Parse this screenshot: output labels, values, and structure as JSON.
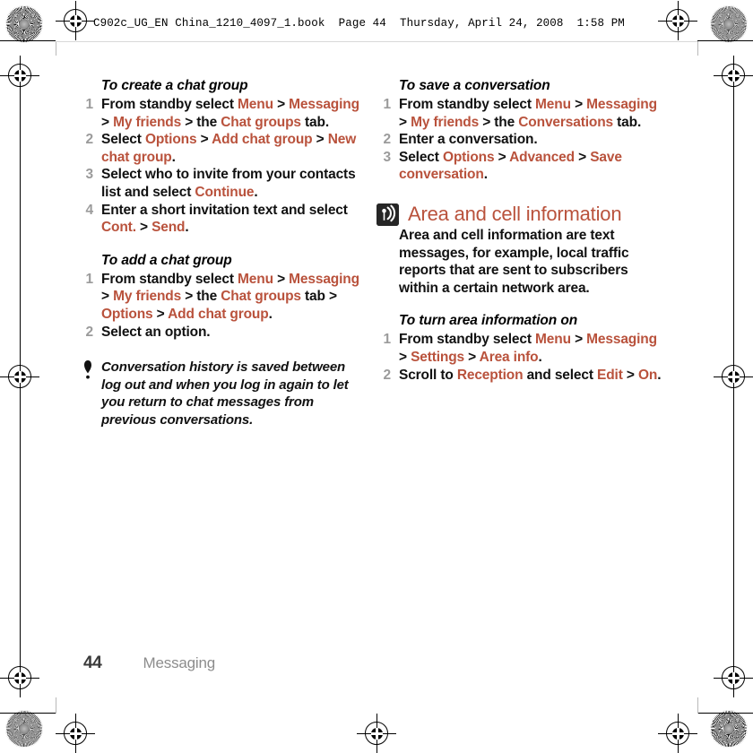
{
  "print_header": {
    "text": "C902c_UG_EN China_1210_4097_1.book  Page 44  Thursday, April 24, 2008  1:58 PM"
  },
  "accent_color": "#b9523c",
  "number_color": "#9b9b9b",
  "left_column": {
    "sections": [
      {
        "heading": "To create a chat group",
        "steps": [
          [
            {
              "t": "plain",
              "v": "From standby select "
            },
            {
              "t": "ui",
              "v": "Menu"
            },
            {
              "t": "sep",
              "v": " > "
            },
            {
              "t": "ui",
              "v": "Messaging"
            },
            {
              "t": "sep",
              "v": " > "
            },
            {
              "t": "ui",
              "v": "My friends"
            },
            {
              "t": "sep",
              "v": " > "
            },
            {
              "t": "plain",
              "v": "the "
            },
            {
              "t": "ui",
              "v": "Chat groups"
            },
            {
              "t": "plain",
              "v": " tab."
            }
          ],
          [
            {
              "t": "plain",
              "v": "Select "
            },
            {
              "t": "ui",
              "v": "Options"
            },
            {
              "t": "sep",
              "v": " > "
            },
            {
              "t": "ui",
              "v": "Add chat group"
            },
            {
              "t": "sep",
              "v": " > "
            },
            {
              "t": "ui",
              "v": "New chat group"
            },
            {
              "t": "plain",
              "v": "."
            }
          ],
          [
            {
              "t": "plain",
              "v": "Select who to invite from your contacts list and select "
            },
            {
              "t": "ui",
              "v": "Continue"
            },
            {
              "t": "plain",
              "v": "."
            }
          ],
          [
            {
              "t": "plain",
              "v": "Enter a short invitation text and select "
            },
            {
              "t": "ui",
              "v": "Cont."
            },
            {
              "t": "sep",
              "v": " > "
            },
            {
              "t": "ui",
              "v": "Send"
            },
            {
              "t": "plain",
              "v": "."
            }
          ]
        ]
      },
      {
        "heading": "To add a chat group",
        "steps": [
          [
            {
              "t": "plain",
              "v": "From standby select "
            },
            {
              "t": "ui",
              "v": "Menu"
            },
            {
              "t": "sep",
              "v": " > "
            },
            {
              "t": "ui",
              "v": "Messaging"
            },
            {
              "t": "sep",
              "v": " > "
            },
            {
              "t": "ui",
              "v": "My friends"
            },
            {
              "t": "sep",
              "v": " > "
            },
            {
              "t": "plain",
              "v": "the "
            },
            {
              "t": "ui",
              "v": "Chat groups"
            },
            {
              "t": "plain",
              "v": " tab "
            },
            {
              "t": "sep",
              "v": "> "
            },
            {
              "t": "ui",
              "v": "Options"
            },
            {
              "t": "sep",
              "v": " > "
            },
            {
              "t": "ui",
              "v": "Add chat group"
            },
            {
              "t": "plain",
              "v": "."
            }
          ],
          [
            {
              "t": "plain",
              "v": "Select an option."
            }
          ]
        ]
      }
    ],
    "tip": {
      "icon": "exclamation-tip-icon",
      "text": "Conversation history is saved between log out and when you log in again to let you return to chat messages from previous conversations."
    }
  },
  "right_column": {
    "sections": [
      {
        "heading": "To save a conversation",
        "steps": [
          [
            {
              "t": "plain",
              "v": "From standby select "
            },
            {
              "t": "ui",
              "v": "Menu"
            },
            {
              "t": "sep",
              "v": " > "
            },
            {
              "t": "ui",
              "v": "Messaging"
            },
            {
              "t": "sep",
              "v": " > "
            },
            {
              "t": "ui",
              "v": "My friends"
            },
            {
              "t": "sep",
              "v": " > "
            },
            {
              "t": "plain",
              "v": "the "
            },
            {
              "t": "ui",
              "v": "Conversations"
            },
            {
              "t": "plain",
              "v": " tab."
            }
          ],
          [
            {
              "t": "plain",
              "v": "Enter a conversation."
            }
          ],
          [
            {
              "t": "plain",
              "v": "Select "
            },
            {
              "t": "ui",
              "v": "Options"
            },
            {
              "t": "sep",
              "v": " > "
            },
            {
              "t": "ui",
              "v": "Advanced"
            },
            {
              "t": "sep",
              "v": " > "
            },
            {
              "t": "ui",
              "v": "Save conversation"
            },
            {
              "t": "plain",
              "v": "."
            }
          ]
        ]
      }
    ],
    "section_heading": {
      "icon": "antenna-broadcast-icon",
      "title": "Area and cell information",
      "paragraph": "Area and cell information are text messages, for example, local traffic reports that are sent to subscribers within a certain network area."
    },
    "sections_after": [
      {
        "heading": "To turn area information on",
        "steps": [
          [
            {
              "t": "plain",
              "v": "From standby select "
            },
            {
              "t": "ui",
              "v": "Menu"
            },
            {
              "t": "sep",
              "v": " > "
            },
            {
              "t": "ui",
              "v": "Messaging"
            },
            {
              "t": "sep",
              "v": " > "
            },
            {
              "t": "ui",
              "v": "Settings"
            },
            {
              "t": "sep",
              "v": " > "
            },
            {
              "t": "ui",
              "v": "Area info"
            },
            {
              "t": "plain",
              "v": "."
            }
          ],
          [
            {
              "t": "plain",
              "v": "Scroll to "
            },
            {
              "t": "ui",
              "v": "Reception"
            },
            {
              "t": "plain",
              "v": " and select "
            },
            {
              "t": "ui",
              "v": "Edit"
            },
            {
              "t": "sep",
              "v": " > "
            },
            {
              "t": "ui",
              "v": "On"
            },
            {
              "t": "plain",
              "v": "."
            }
          ]
        ]
      }
    ]
  },
  "footer": {
    "page_number": "44",
    "chapter": "Messaging"
  }
}
